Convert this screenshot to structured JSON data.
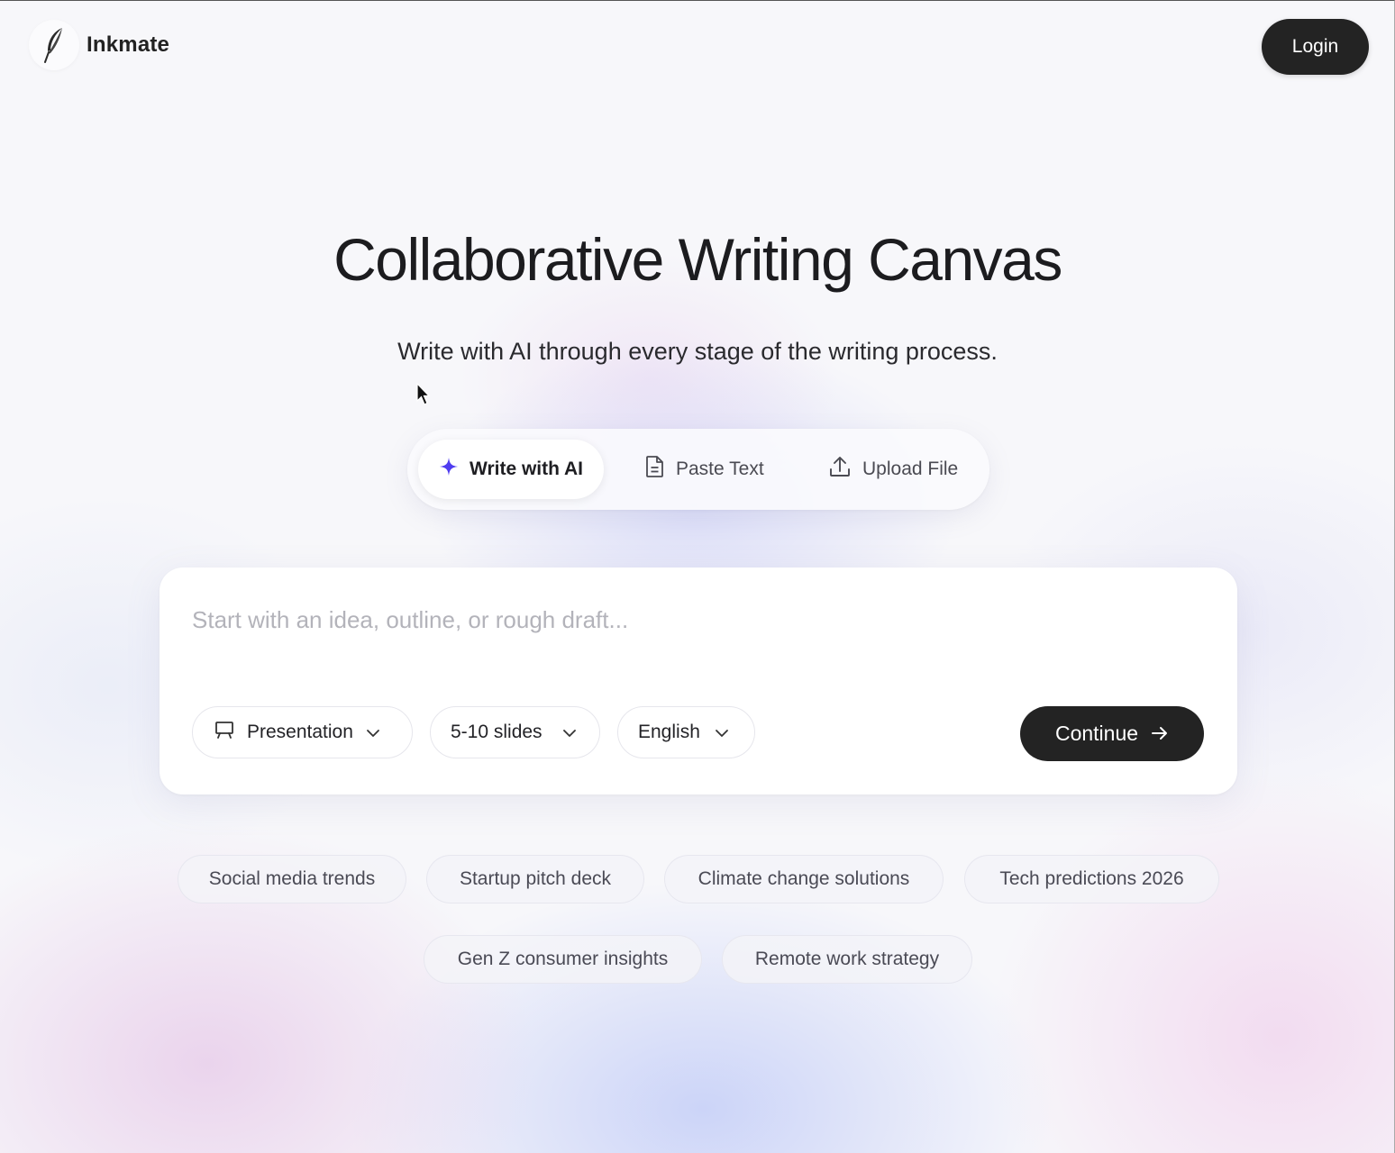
{
  "brand": {
    "name": "Inkmate",
    "logo_icon": "feather-icon"
  },
  "header": {
    "login_label": "Login"
  },
  "hero": {
    "title": "Collaborative Writing Canvas",
    "subtitle": "Write with AI through every stage of the writing process."
  },
  "modes": [
    {
      "label": "Write with AI",
      "icon": "sparkle-icon",
      "active": true
    },
    {
      "label": "Paste Text",
      "icon": "document-icon",
      "active": false
    },
    {
      "label": "Upload File",
      "icon": "upload-icon",
      "active": false
    }
  ],
  "composer": {
    "placeholder": "Start with an idea, outline, or rough draft...",
    "value": "",
    "format": "Presentation",
    "length": "5-10 slides",
    "language": "English",
    "continue_label": "Continue"
  },
  "suggestions": [
    "Social media trends",
    "Startup pitch deck",
    "Climate change solutions",
    "Tech predictions 2026",
    "Gen Z consumer insights",
    "Remote work strategy"
  ],
  "colors": {
    "accent": "#4f3cf0",
    "dark_button": "#232323",
    "background": "#f7f7fa"
  }
}
